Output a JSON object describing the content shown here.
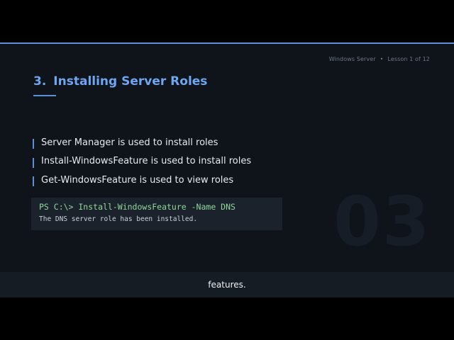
{
  "header": {
    "course": "Windows Server",
    "separator": "•",
    "lesson": "Lesson 1 of 12"
  },
  "slide": {
    "number": "3.",
    "title": "Installing Server Roles",
    "bullets": [
      "Server Manager is used to install roles",
      "Install-WindowsFeature is used to install roles",
      "Get-WindowsFeature is used to view roles"
    ],
    "terminal": {
      "command": "PS C:\\> Install-WindowsFeature -Name DNS",
      "output": "The DNS server role has been installed."
    },
    "watermark": "03"
  },
  "caption": "features.",
  "colors": {
    "accent": "#5b8fd6",
    "title": "#6ea6f2",
    "slide_bg": "#0f141b",
    "terminal_bg": "#1b222c",
    "command_text": "#8fd79a"
  }
}
